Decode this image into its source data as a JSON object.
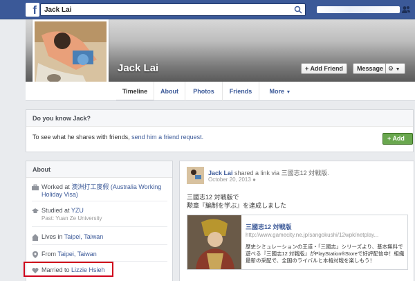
{
  "topbar": {
    "logo": "f",
    "search_value": "Jack Lai"
  },
  "profile": {
    "name": "Jack Lai",
    "add_friend": "Add Friend",
    "message": "Message"
  },
  "tabs": [
    {
      "label": "Timeline"
    },
    {
      "label": "About"
    },
    {
      "label": "Photos"
    },
    {
      "label": "Friends"
    },
    {
      "label": "More"
    }
  ],
  "know_card": {
    "title": "Do you know Jack?",
    "text": "To see what he shares with friends, ",
    "link": "send him a friend request.",
    "button": "Add Friend"
  },
  "about": {
    "title": "About",
    "items": [
      {
        "prefix": "Worked at ",
        "value": "澳洲打工度假 (Australia Working Holiday Visa)",
        "sub": ""
      },
      {
        "prefix": "Studied at ",
        "value": "YZU",
        "sub": "Past: Yuan Ze University"
      },
      {
        "prefix": "Lives in ",
        "value": "Taipei, Taiwan",
        "sub": ""
      },
      {
        "prefix": "From ",
        "value": "Taipei, Taiwan",
        "sub": ""
      },
      {
        "prefix": "Married to ",
        "value": "Lizzie Hsieh",
        "sub": ""
      }
    ]
  },
  "post": {
    "author": "Jack Lai",
    "action": " shared a link via 三國志12 対戦版.",
    "date": "October 20, 2013",
    "line1": "三國志12 対戦版で",
    "line2": "勲章『編制を学ぶ』を達成しました",
    "share_title": "三國志12 対戦版",
    "share_url": "http://www.gamecity.ne.jp/sangokushi/12wpk/netplay...",
    "share_desc": "歴史シミュレーションの王道・「三國志」シリーズより、基本無料で遊べる『三國志12 対戦版』がPlayStation®Storeで好評配信中！組織最新の采配で、全国のライバルと本格対戦を楽しもう！"
  },
  "colors": {
    "topbar": "#3b5998",
    "link": "#3b5998",
    "green_button": "#69a74e",
    "highlight": "#d0021b"
  }
}
